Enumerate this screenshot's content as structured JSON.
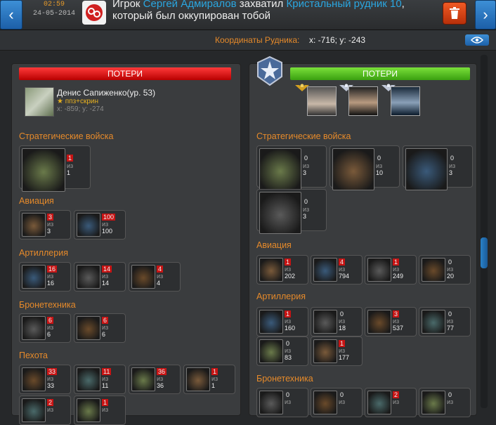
{
  "header": {
    "time": "02:59",
    "date": "24-05-2014",
    "message_prefix": "Игрок",
    "message_player": "Сергей Адмиралов",
    "message_mid": "захватил",
    "message_mine": "Кристальный рудник 10",
    "message_suffix": ", который был оккупирован тобой",
    "nav_left_icon": "chevron-left-icon",
    "nav_right_icon": "chevron-right-icon",
    "delete_icon": "trash-icon"
  },
  "coords": {
    "label": "Координаты Рудника:",
    "value": "x: -716; y: -243",
    "view_icon": "eye-icon"
  },
  "of_label": "из",
  "left": {
    "losses_title": "ПОТЕРИ",
    "player": {
      "name": "Денис Сапиженко(ур. 53)",
      "tag": "★ ппз+скрин",
      "coords": "x: -859; y: -274"
    },
    "categories": [
      {
        "name": "Стратегические войска",
        "units": [
          {
            "lost": "1",
            "total": "1"
          }
        ]
      },
      {
        "name": "Авиация",
        "units": [
          {
            "lost": "3",
            "total": "3"
          },
          {
            "lost": "100",
            "total": "100"
          }
        ]
      },
      {
        "name": "Артиллерия",
        "units": [
          {
            "lost": "16",
            "total": "16"
          },
          {
            "lost": "14",
            "total": "14"
          },
          {
            "lost": "4",
            "total": "4"
          }
        ]
      },
      {
        "name": "Бронетехника",
        "units": [
          {
            "lost": "6",
            "total": "6"
          },
          {
            "lost": "6",
            "total": "6"
          }
        ]
      },
      {
        "name": "Пехота",
        "units": [
          {
            "lost": "33",
            "total": "33"
          },
          {
            "lost": "11",
            "total": "11"
          },
          {
            "lost": "36",
            "total": "36"
          },
          {
            "lost": "1",
            "total": "1"
          }
        ]
      },
      {
        "name": "",
        "units": [
          {
            "lost": "2",
            "total": ""
          },
          {
            "lost": "1",
            "total": ""
          }
        ]
      }
    ]
  },
  "right": {
    "losses_title": "ПОТЕРИ",
    "categories": [
      {
        "name": "Стратегические войска",
        "units": [
          {
            "lost": "0",
            "total": "3"
          },
          {
            "lost": "0",
            "total": "10"
          },
          {
            "lost": "0",
            "total": "3"
          },
          {
            "lost": "0",
            "total": "3"
          }
        ]
      },
      {
        "name": "Авиация",
        "units": [
          {
            "lost": "1",
            "total": "202"
          },
          {
            "lost": "4",
            "total": "794"
          },
          {
            "lost": "1",
            "total": "249"
          },
          {
            "lost": "0",
            "total": "20"
          }
        ]
      },
      {
        "name": "Артиллерия",
        "units": [
          {
            "lost": "1",
            "total": "160"
          },
          {
            "lost": "0",
            "total": "18"
          },
          {
            "lost": "3",
            "total": "537"
          },
          {
            "lost": "0",
            "total": "77"
          },
          {
            "lost": "0",
            "total": "83"
          },
          {
            "lost": "1",
            "total": "177"
          }
        ]
      },
      {
        "name": "Бронетехника",
        "units": [
          {
            "lost": "0",
            "total": ""
          },
          {
            "lost": "0",
            "total": ""
          },
          {
            "lost": "2",
            "total": ""
          },
          {
            "lost": "0",
            "total": ""
          }
        ]
      }
    ]
  },
  "colors": {
    "accent": "#e68a2a",
    "loss_red": "#c81414",
    "link_blue": "#2aa6e0",
    "bar_red": "#e01010",
    "bar_green": "#5ac820"
  }
}
